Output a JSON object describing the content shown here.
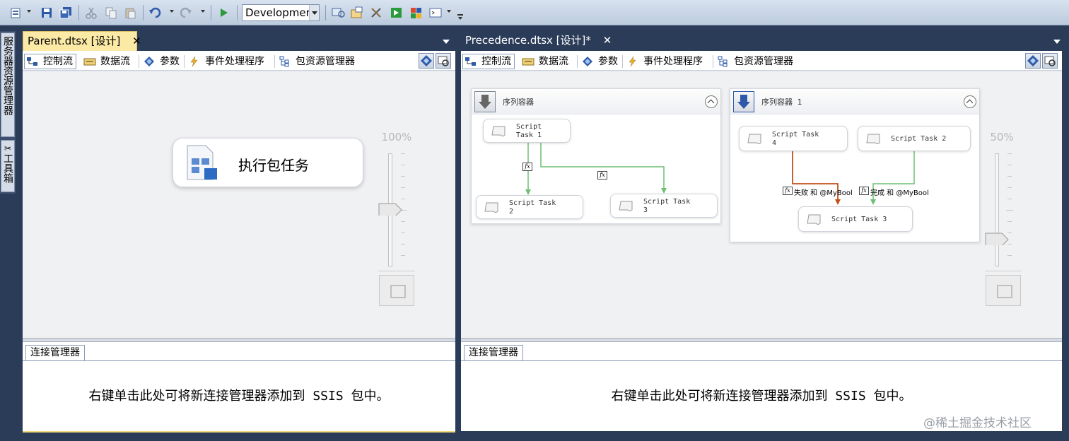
{
  "toolbar": {
    "configuration": "Developmer",
    "icons": [
      "new-item-icon",
      "save-icon",
      "save-all-icon",
      "cut-icon",
      "copy-icon",
      "paste-icon",
      "undo-icon",
      "redo-icon",
      "start-icon",
      "properties-icon",
      "solution-explorer-icon",
      "toolbox-icon",
      "object-browser-icon",
      "class-view-icon",
      "command-window-icon"
    ]
  },
  "side_tabs": {
    "server_explorer": "服务器资源管理器",
    "toolbox": "工具箱"
  },
  "designer_tabs": [
    "控制流",
    "数据流",
    "参数",
    "事件处理程序",
    "包资源管理器"
  ],
  "left_panel": {
    "tab_title": "Parent.dtsx [设计]",
    "zoom": "100%",
    "task_label": "执行包任务",
    "connection_tab": "连接管理器",
    "connection_message": "右键单击此处可将新连接管理器添加到 SSIS 包中。"
  },
  "right_panel": {
    "tab_title": "Precedence.dtsx [设计]*",
    "zoom": "50%",
    "connection_tab": "连接管理器",
    "connection_message": "右键单击此处可将新连接管理器添加到 SSIS 包中。",
    "container1": {
      "title": "序列容器",
      "tasks": [
        "Script\nTask 1",
        "Script Task\n2",
        "Script Task\n3"
      ]
    },
    "container2": {
      "title": "序列容器 1",
      "tasks": [
        "Script Task\n4",
        "Script Task 2",
        "Script Task 3"
      ],
      "constraint_fail": "失败 和 @MyBool",
      "constraint_done": "完成 和 @MyBool"
    }
  },
  "fx_symbol": "fx",
  "watermark": "@稀土掘金技术社区",
  "colors": {
    "active_tab": "#fbe9a6",
    "success_line": "#6fbf73",
    "failure_line": "#c2501a",
    "completion_line": "#6fbf73"
  }
}
